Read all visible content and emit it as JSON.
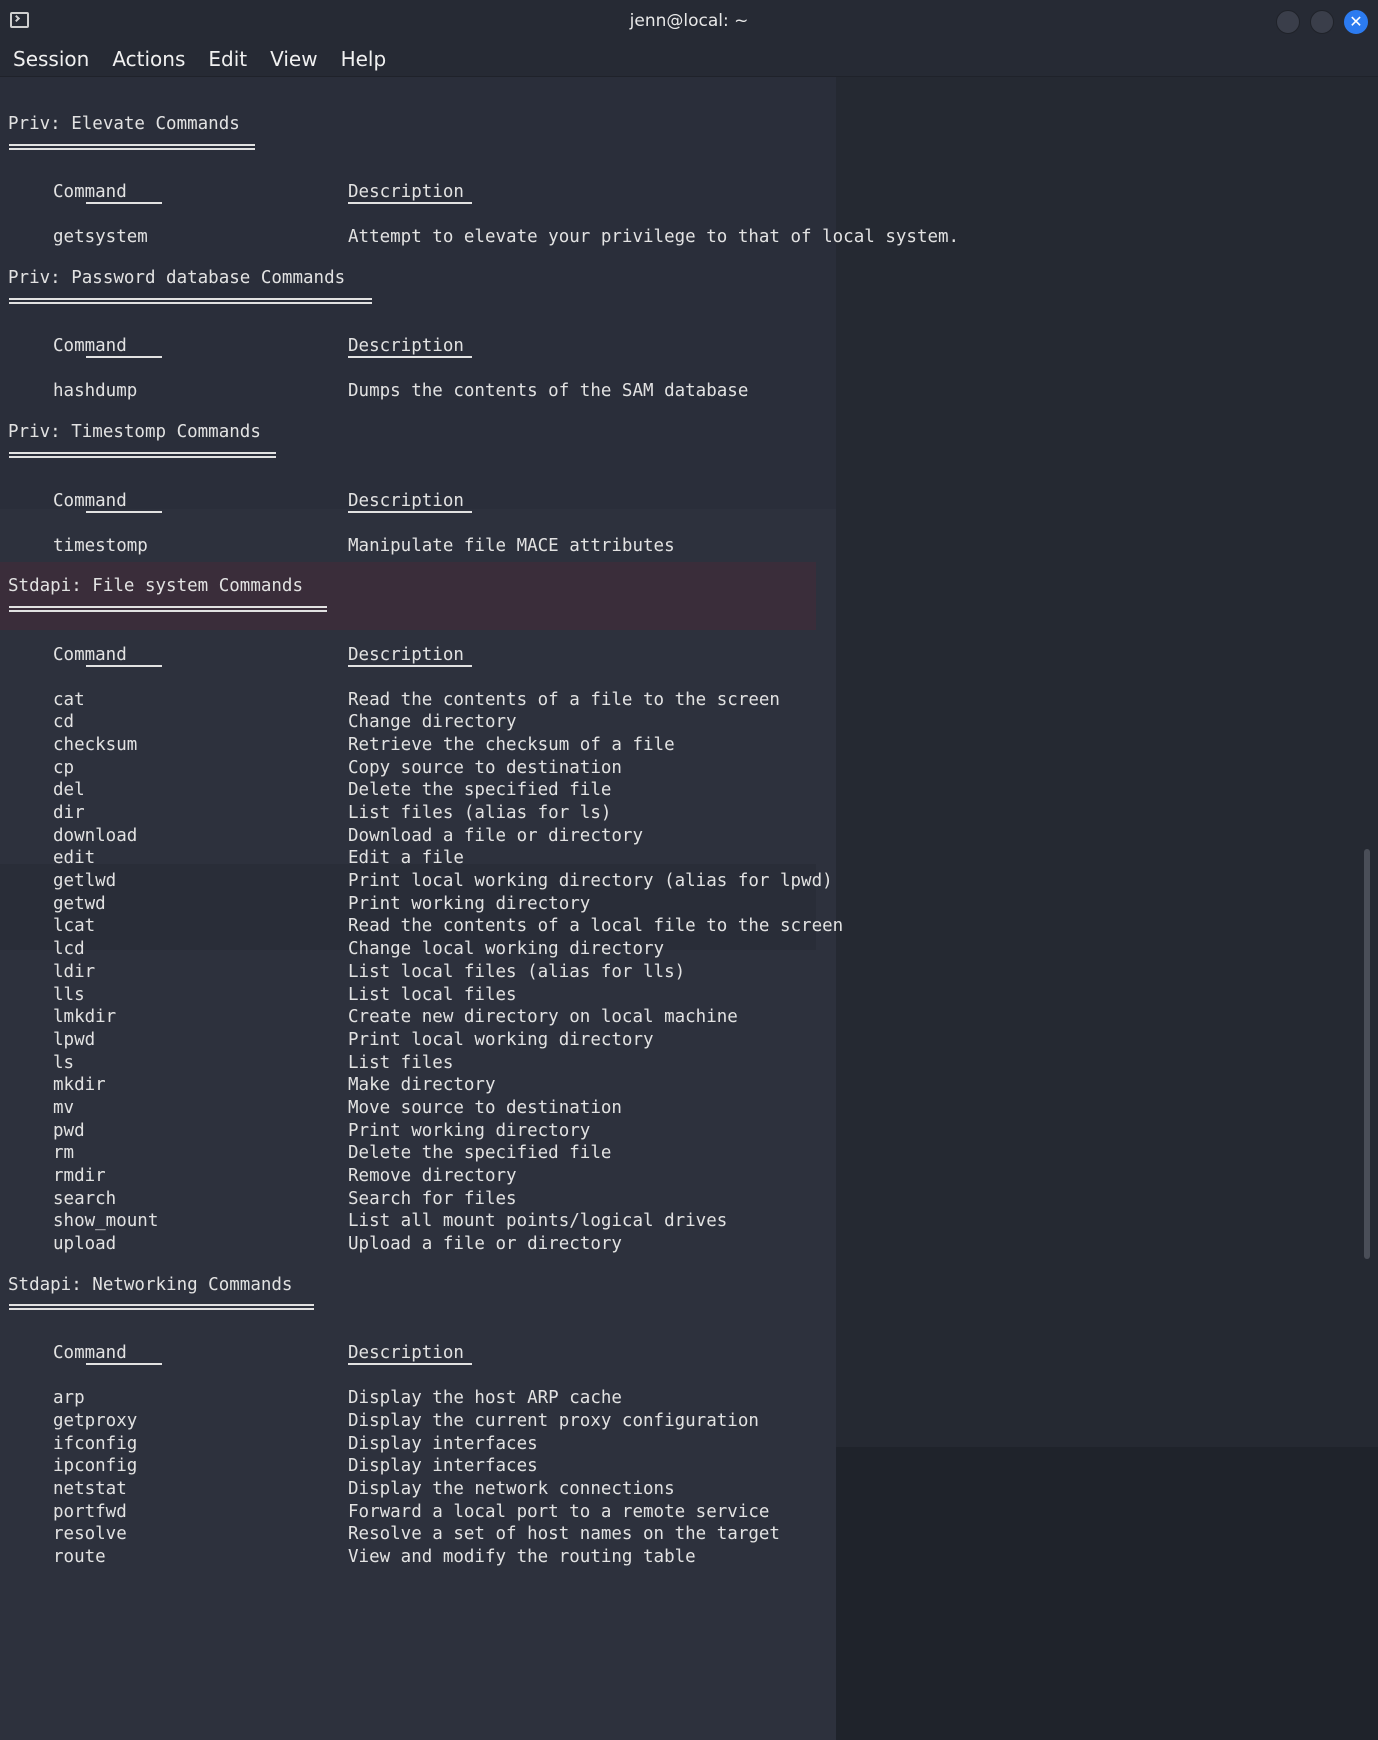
{
  "window": {
    "title": "jenn@local: ~",
    "close_glyph": "✕"
  },
  "menu": [
    "Session",
    "Actions",
    "Edit",
    "View",
    "Help"
  ],
  "sections": [
    {
      "title": "Priv: Elevate Commands",
      "header": {
        "command": "Command",
        "description": "Description"
      },
      "rows": [
        {
          "command": "getsystem",
          "description": "Attempt to elevate your privilege to that of local system."
        }
      ]
    },
    {
      "title": "Priv: Password database Commands",
      "header": {
        "command": "Command",
        "description": "Description"
      },
      "rows": [
        {
          "command": "hashdump",
          "description": "Dumps the contents of the SAM database"
        }
      ]
    },
    {
      "title": "Priv: Timestomp Commands",
      "header": {
        "command": "Command",
        "description": "Description"
      },
      "rows": [
        {
          "command": "timestomp",
          "description": "Manipulate file MACE attributes"
        }
      ]
    },
    {
      "title": "Stdapi: File system Commands",
      "header": {
        "command": "Command",
        "description": "Description"
      },
      "rows": [
        {
          "command": "cat",
          "description": "Read the contents of a file to the screen"
        },
        {
          "command": "cd",
          "description": "Change directory"
        },
        {
          "command": "checksum",
          "description": "Retrieve the checksum of a file"
        },
        {
          "command": "cp",
          "description": "Copy source to destination"
        },
        {
          "command": "del",
          "description": "Delete the specified file"
        },
        {
          "command": "dir",
          "description": "List files (alias for ls)"
        },
        {
          "command": "download",
          "description": "Download a file or directory"
        },
        {
          "command": "edit",
          "description": "Edit a file"
        },
        {
          "command": "getlwd",
          "description": "Print local working directory (alias for lpwd)"
        },
        {
          "command": "getwd",
          "description": "Print working directory"
        },
        {
          "command": "lcat",
          "description": "Read the contents of a local file to the screen"
        },
        {
          "command": "lcd",
          "description": "Change local working directory"
        },
        {
          "command": "ldir",
          "description": "List local files (alias for lls)"
        },
        {
          "command": "lls",
          "description": "List local files"
        },
        {
          "command": "lmkdir",
          "description": "Create new directory on local machine"
        },
        {
          "command": "lpwd",
          "description": "Print local working directory"
        },
        {
          "command": "ls",
          "description": "List files"
        },
        {
          "command": "mkdir",
          "description": "Make directory"
        },
        {
          "command": "mv",
          "description": "Move source to destination"
        },
        {
          "command": "pwd",
          "description": "Print working directory"
        },
        {
          "command": "rm",
          "description": "Delete the specified file"
        },
        {
          "command": "rmdir",
          "description": "Remove directory"
        },
        {
          "command": "search",
          "description": "Search for files"
        },
        {
          "command": "show_mount",
          "description": "List all mount points/logical drives"
        },
        {
          "command": "upload",
          "description": "Upload a file or directory"
        }
      ]
    },
    {
      "title": "Stdapi: Networking Commands",
      "header": {
        "command": "Command",
        "description": "Description"
      },
      "rows": [
        {
          "command": "arp",
          "description": "Display the host ARP cache"
        },
        {
          "command": "getproxy",
          "description": "Display the current proxy configuration"
        },
        {
          "command": "ifconfig",
          "description": "Display interfaces"
        },
        {
          "command": "ipconfig",
          "description": "Display interfaces"
        },
        {
          "command": "netstat",
          "description": "Display the network connections"
        },
        {
          "command": "portfwd",
          "description": "Forward a local port to a remote service"
        },
        {
          "command": "resolve",
          "description": "Resolve a set of host names on the target"
        },
        {
          "command": "route",
          "description": "View and modify the routing table"
        }
      ]
    }
  ]
}
